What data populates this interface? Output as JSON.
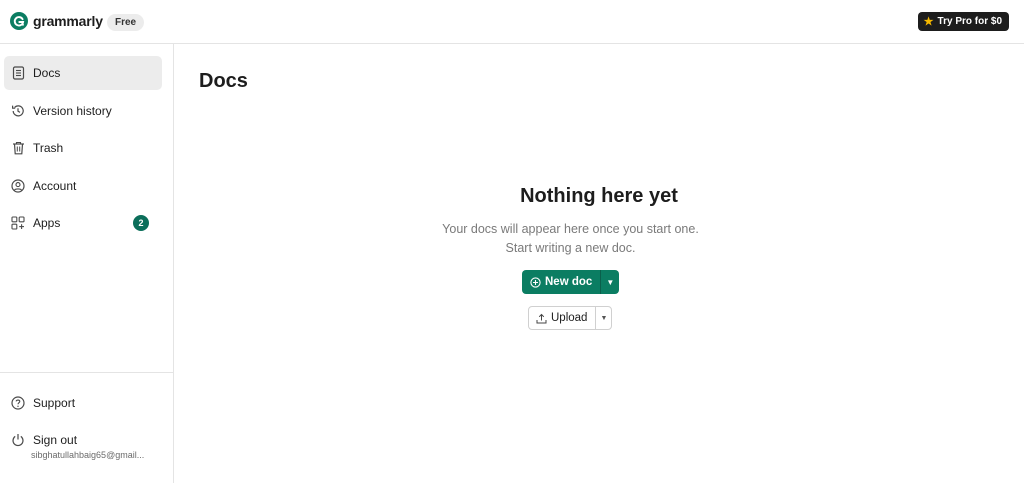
{
  "header": {
    "brand_name": "grammarly",
    "plan_badge": "Free",
    "try_pro_label": "Try Pro for $0"
  },
  "sidebar": {
    "items": [
      {
        "label": "Docs",
        "icon": "document-icon",
        "active": true
      },
      {
        "label": "Version history",
        "icon": "history-icon"
      },
      {
        "label": "Trash",
        "icon": "trash-icon"
      },
      {
        "label": "Account",
        "icon": "account-icon"
      },
      {
        "label": "Apps",
        "icon": "apps-icon",
        "count": "2"
      }
    ],
    "footer": [
      {
        "label": "Support",
        "icon": "help-icon"
      },
      {
        "label": "Sign out",
        "icon": "power-icon",
        "email": "sibghatullahbaig65@gmail..."
      }
    ]
  },
  "main": {
    "title": "Docs",
    "empty_title": "Nothing here yet",
    "empty_line1": "Your docs will appear here once you start one.",
    "empty_line2": "Start writing a new doc.",
    "new_doc_label": "New doc",
    "upload_label": "Upload"
  },
  "colors": {
    "accent": "#0b7d62",
    "badge": "#0b6e5a",
    "brand_dark": "#1d1d1d",
    "star": "#f5b800"
  }
}
